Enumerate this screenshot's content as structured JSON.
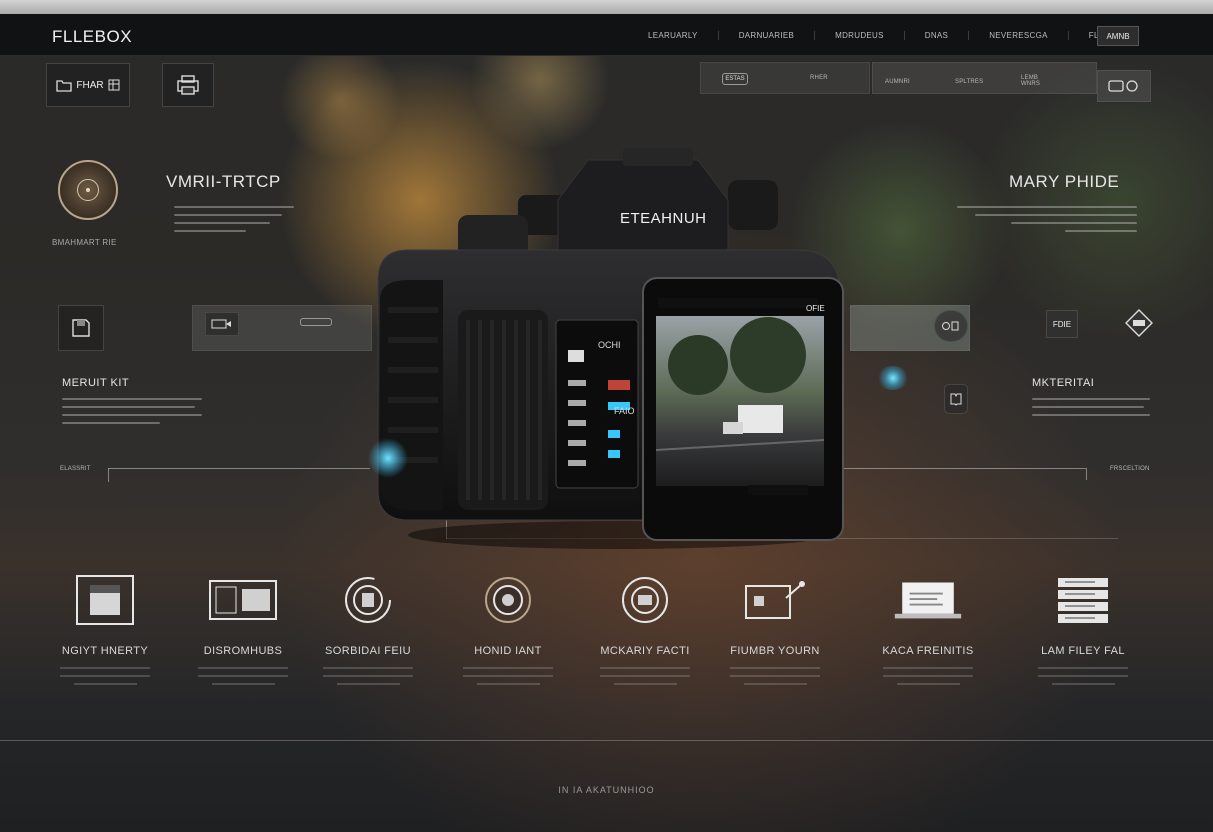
{
  "app": {
    "logo": "FLLEBOX"
  },
  "header": {
    "nav": [
      "LEARUARLY",
      "DARNUARIEB",
      "MDRUDEUS",
      "DNAS",
      "NEVERESCGA",
      "FLRBRBOS"
    ],
    "button": "AMNB"
  },
  "toolbar": {
    "left_tile_label": "FHAR",
    "strip_pill": "ESTAS",
    "strip_text_1": "RHER",
    "strip_text_2": "AUMNRI",
    "strip_text_3": "SPLTRES",
    "strip_text_4": "LEMB WNRS"
  },
  "left_panel": {
    "title": "VMRII-TRTCP",
    "caption": "BMAHMART RIE",
    "subtitle": "MERUIT KIT"
  },
  "right_panel": {
    "title": "MARY PHIDE",
    "subtitle": "MKTERITAI",
    "tile_label": "FDIE"
  },
  "camera": {
    "brand": "ETEAHNUH",
    "screen_label": "OFIE",
    "panel_label": "OCHI",
    "readout": "FAIO"
  },
  "connectors": {
    "left_tag": "ELASSRIT",
    "right_tag": "FRSCELTION"
  },
  "features": [
    {
      "label": "NGIYT HNERTY",
      "icon": "floppy-disk-icon"
    },
    {
      "label": "DISROMHUBS",
      "icon": "window-icon"
    },
    {
      "label": "SORBIDAI FEIU",
      "icon": "dial-icon"
    },
    {
      "label": "HONID IANT",
      "icon": "lens-icon"
    },
    {
      "label": "MCKARIY FACTI",
      "icon": "shutter-icon"
    },
    {
      "label": "FIUMBR YOURN",
      "icon": "edit-card-icon"
    },
    {
      "label": "KACA FREINITIS",
      "icon": "laptop-icon"
    },
    {
      "label": "LAM FILEY FAL",
      "icon": "stack-icon"
    }
  ],
  "footer": {
    "text": "IN IA AKATUNHIOO"
  },
  "colors": {
    "accent": "#39c6ff",
    "header_bg": "#111214",
    "warm_bokeh": "#ffb455"
  }
}
